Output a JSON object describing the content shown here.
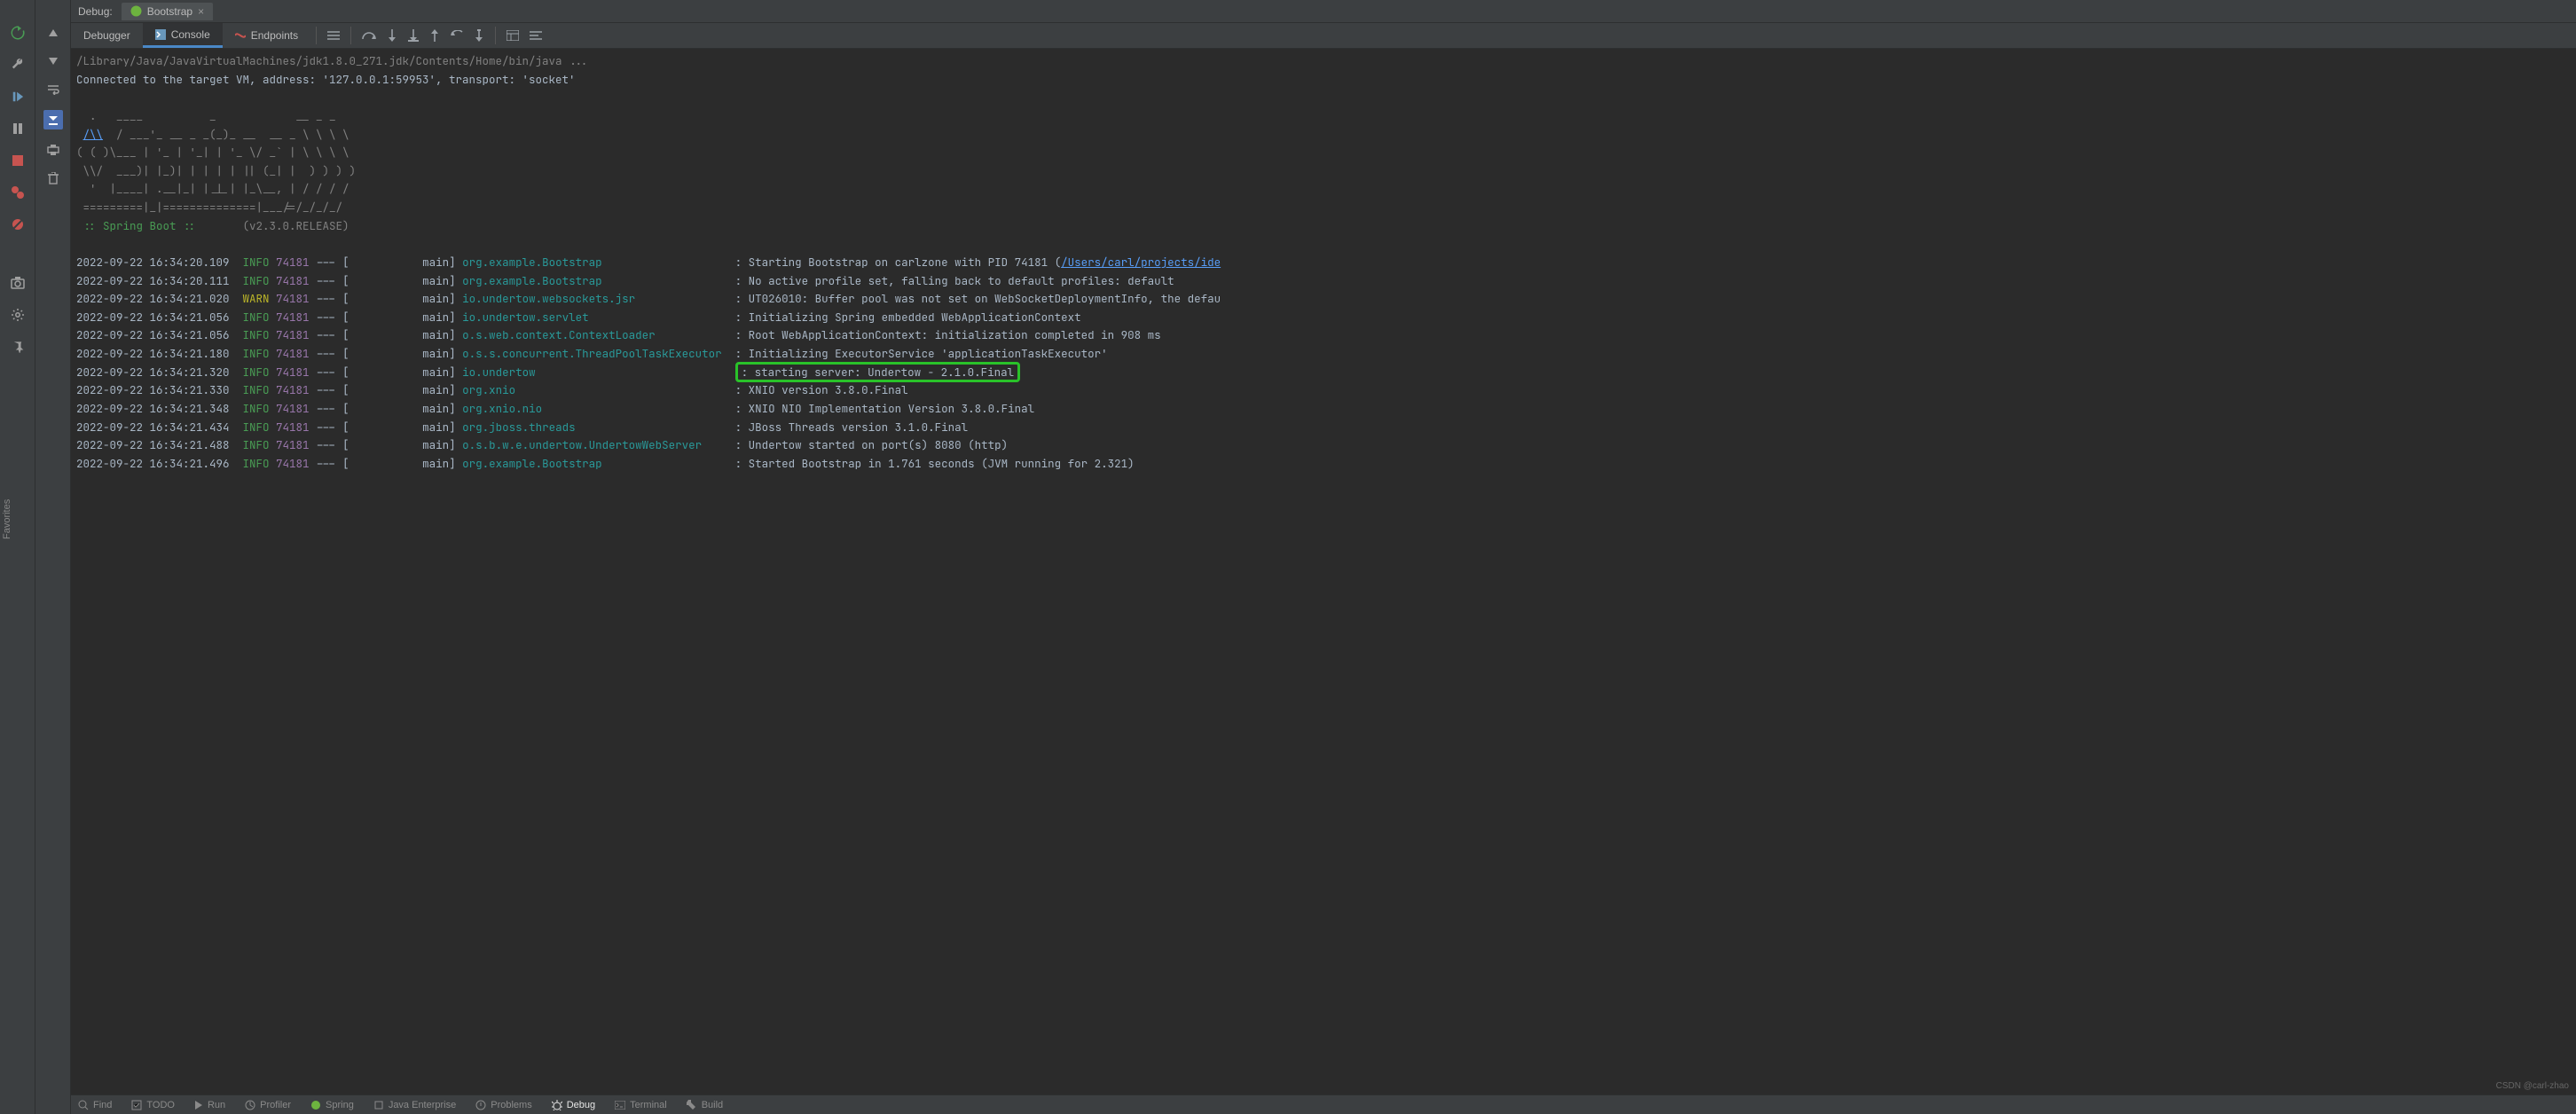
{
  "headerLabel": "Debug:",
  "runConfig": "Bootstrap",
  "tabs": {
    "debugger": "Debugger",
    "console": "Console",
    "endpoints": "Endpoints"
  },
  "console": {
    "cmdLine": "/Library/Java/JavaVirtualMachines/jdk1.8.0_271.jdk/Contents/Home/bin/java ...",
    "connected": "Connected to the target VM, address: '127.0.0.1:59953', transport: 'socket'",
    "banner": [
      "  .   ____          _            __ _ _",
      " /\\\\ / ___'_ __ _ _(_)_ __  __ _ \\ \\ \\ \\",
      "( ( )\\___ | '_ | '_| | '_ \\/ _` | \\ \\ \\ \\",
      " \\\\/  ___)| |_)| | | | | || (_| |  ) ) ) )",
      "  '  |____| .__|_| |_|_| |_\\__, | / / / /",
      " =========|_|==============|___/=/_/_/_/"
    ],
    "springBoot": " :: Spring Boot ::",
    "version": "(v2.3.0.RELEASE)",
    "logs": [
      {
        "ts": "2022-09-22 16:34:20.109",
        "lvl": "INFO",
        "pid": "74181",
        "thread": "main",
        "logger": "org.example.Bootstrap",
        "msgPre": "Starting Bootstrap on carlzone with PID 74181 (",
        "link": "/Users/carl/projects/ide"
      },
      {
        "ts": "2022-09-22 16:34:20.111",
        "lvl": "INFO",
        "pid": "74181",
        "thread": "main",
        "logger": "org.example.Bootstrap",
        "msg": "No active profile set, falling back to default profiles: default"
      },
      {
        "ts": "2022-09-22 16:34:21.020",
        "lvl": "WARN",
        "pid": "74181",
        "thread": "main",
        "logger": "io.undertow.websockets.jsr",
        "msg": "UT026010: Buffer pool was not set on WebSocketDeploymentInfo, the defau"
      },
      {
        "ts": "2022-09-22 16:34:21.056",
        "lvl": "INFO",
        "pid": "74181",
        "thread": "main",
        "logger": "io.undertow.servlet",
        "msg": "Initializing Spring embedded WebApplicationContext"
      },
      {
        "ts": "2022-09-22 16:34:21.056",
        "lvl": "INFO",
        "pid": "74181",
        "thread": "main",
        "logger": "o.s.web.context.ContextLoader",
        "msg": "Root WebApplicationContext: initialization completed in 908 ms"
      },
      {
        "ts": "2022-09-22 16:34:21.180",
        "lvl": "INFO",
        "pid": "74181",
        "thread": "main",
        "logger": "o.s.s.concurrent.ThreadPoolTaskExecutor",
        "msg": "Initializing ExecutorService 'applicationTaskExecutor'"
      },
      {
        "ts": "2022-09-22 16:34:21.320",
        "lvl": "INFO",
        "pid": "74181",
        "thread": "main",
        "logger": "io.undertow",
        "msg": "starting server: Undertow - 2.1.0.Final",
        "highlight": true
      },
      {
        "ts": "2022-09-22 16:34:21.330",
        "lvl": "INFO",
        "pid": "74181",
        "thread": "main",
        "logger": "org.xnio",
        "msg": "XNIO version 3.8.0.Final"
      },
      {
        "ts": "2022-09-22 16:34:21.348",
        "lvl": "INFO",
        "pid": "74181",
        "thread": "main",
        "logger": "org.xnio.nio",
        "msg": "XNIO NIO Implementation Version 3.8.0.Final"
      },
      {
        "ts": "2022-09-22 16:34:21.434",
        "lvl": "INFO",
        "pid": "74181",
        "thread": "main",
        "logger": "org.jboss.threads",
        "msg": "JBoss Threads version 3.1.0.Final"
      },
      {
        "ts": "2022-09-22 16:34:21.488",
        "lvl": "INFO",
        "pid": "74181",
        "thread": "main",
        "logger": "o.s.b.w.e.undertow.UndertowWebServer",
        "msg": "Undertow started on port(s) 8080 (http)"
      },
      {
        "ts": "2022-09-22 16:34:21.496",
        "lvl": "INFO",
        "pid": "74181",
        "thread": "main",
        "logger": "org.example.Bootstrap",
        "msg": "Started Bootstrap in 1.761 seconds (JVM running for 2.321)"
      }
    ]
  },
  "bottom": {
    "find": "Find",
    "todo": "TODO",
    "run": "Run",
    "profiler": "Profiler",
    "spring": "Spring",
    "javaee": "Java Enterprise",
    "problems": "Problems",
    "debug": "Debug",
    "terminal": "Terminal",
    "build": "Build"
  },
  "watermark": "CSDN @carl-zhao",
  "sideText": "Favorites"
}
